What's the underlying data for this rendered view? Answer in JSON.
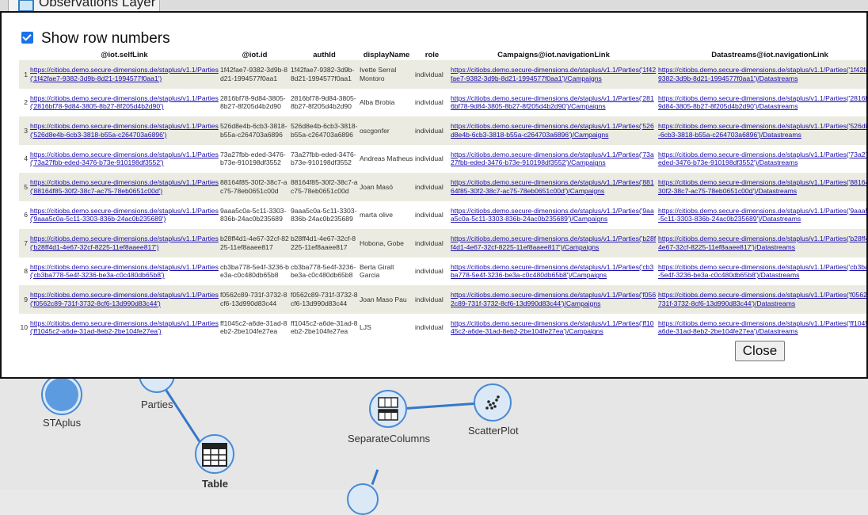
{
  "background": {
    "tab_label": "Observations Layer",
    "nodes": [
      {
        "id": "staplus",
        "label": "STAplus",
        "icon": "staplus-icon"
      },
      {
        "id": "parties",
        "label": "Parties",
        "icon": "parties-icon"
      },
      {
        "id": "table",
        "label": "Table",
        "icon": "table-icon"
      },
      {
        "id": "separatecolumns",
        "label": "SeparateColumns",
        "icon": "separate-columns-icon"
      },
      {
        "id": "scatterplot",
        "label": "ScatterPlot",
        "icon": "scatter-plot-icon"
      }
    ]
  },
  "modal": {
    "show_row_numbers_label": "Show row numbers",
    "show_row_numbers_checked": true,
    "close_label": "Close",
    "columns": [
      "@iot.selfLink",
      "@iot.id",
      "authId",
      "displayName",
      "role",
      "Campaigns@iot.navigationLink",
      "Datastreams@iot.navigationLink"
    ],
    "rows": [
      {
        "n": "1",
        "self": "https://citiobs.demo.secure-dimensions.de/staplus/v1.1/Parties('1f42fae7-9382-3d9b-8d21-1994577f0aa1')",
        "id": "1f42fae7-9382-3d9b-8d21-1994577f0aa1",
        "auth": "1f42fae7-9382-3d9b-8d21-1994577f0aa1",
        "name": "Ivette Serral Montoro",
        "role": "individual",
        "camp": "https://citiobs.demo.secure-dimensions.de/staplus/v1.1/Parties('1f42fae7-9382-3d9b-8d21-1994577f0aa1')/Campaigns",
        "ds": "https://citiobs.demo.secure-dimensions.de/staplus/v1.1/Parties('1f42fae7-9382-3d9b-8d21-1994577f0aa1')/Datastreams"
      },
      {
        "n": "2",
        "self": "https://citiobs.demo.secure-dimensions.de/staplus/v1.1/Parties('2816bf78-9d84-3805-8b27-8f205d4b2d90')",
        "id": "2816bf78-9d84-3805-8b27-8f205d4b2d90",
        "auth": "2816bf78-9d84-3805-8b27-8f205d4b2d90",
        "name": "Alba Brobia",
        "role": "individual",
        "camp": "https://citiobs.demo.secure-dimensions.de/staplus/v1.1/Parties('2816bf78-9d84-3805-8b27-8f205d4b2d90')/Campaigns",
        "ds": "https://citiobs.demo.secure-dimensions.de/staplus/v1.1/Parties('2816bf78-9d84-3805-8b27-8f205d4b2d90')/Datastreams"
      },
      {
        "n": "3",
        "self": "https://citiobs.demo.secure-dimensions.de/staplus/v1.1/Parties('526d8e4b-6cb3-3818-b55a-c264703a6896')",
        "id": "526d8e4b-6cb3-3818-b55a-c264703a6896",
        "auth": "526d8e4b-6cb3-3818-b55a-c264703a6896",
        "name": "oscgonfer",
        "role": "individual",
        "camp": "https://citiobs.demo.secure-dimensions.de/staplus/v1.1/Parties('526d8e4b-6cb3-3818-b55a-c264703a6896')/Campaigns",
        "ds": "https://citiobs.demo.secure-dimensions.de/staplus/v1.1/Parties('526d8e4b-6cb3-3818-b55a-c264703a6896')/Datastreams"
      },
      {
        "n": "4",
        "self": "https://citiobs.demo.secure-dimensions.de/staplus/v1.1/Parties('73a27fbb-eded-3476-b73e-910198df3552')",
        "id": "73a27fbb-eded-3476-b73e-910198df3552",
        "auth": "73a27fbb-eded-3476-b73e-910198df3552",
        "name": "Andreas Matheus",
        "role": "individual",
        "camp": "https://citiobs.demo.secure-dimensions.de/staplus/v1.1/Parties('73a27fbb-eded-3476-b73e-910198df3552')/Campaigns",
        "ds": "https://citiobs.demo.secure-dimensions.de/staplus/v1.1/Parties('73a27fbb-eded-3476-b73e-910198df3552')/Datastreams"
      },
      {
        "n": "5",
        "self": "https://citiobs.demo.secure-dimensions.de/staplus/v1.1/Parties('88164f85-30f2-38c7-ac75-78eb0651c00d')",
        "id": "88164f85-30f2-38c7-ac75-78eb0651c00d",
        "auth": "88164f85-30f2-38c7-ac75-78eb0651c00d",
        "name": "Joan Masó",
        "role": "individual",
        "camp": "https://citiobs.demo.secure-dimensions.de/staplus/v1.1/Parties('88164f85-30f2-38c7-ac75-78eb0651c00d')/Campaigns",
        "ds": "https://citiobs.demo.secure-dimensions.de/staplus/v1.1/Parties('88164f85-30f2-38c7-ac75-78eb0651c00d')/Datastreams"
      },
      {
        "n": "6",
        "self": "https://citiobs.demo.secure-dimensions.de/staplus/v1.1/Parties('9aaa5c0a-5c11-3303-836b-24ac0b235689')",
        "id": "9aaa5c0a-5c11-3303-836b-24ac0b235689",
        "auth": "9aaa5c0a-5c11-3303-836b-24ac0b235689",
        "name": "marta olive",
        "role": "individual",
        "camp": "https://citiobs.demo.secure-dimensions.de/staplus/v1.1/Parties('9aaa5c0a-5c11-3303-836b-24ac0b235689')/Campaigns",
        "ds": "https://citiobs.demo.secure-dimensions.de/staplus/v1.1/Parties('9aaa5c0a-5c11-3303-836b-24ac0b235689')/Datastreams"
      },
      {
        "n": "7",
        "self": "https://citiobs.demo.secure-dimensions.de/staplus/v1.1/Parties('b28ff4d1-4e67-32cf-8225-11ef8aaee817')",
        "id": "b28ff4d1-4e67-32cf-8225-11ef8aaee817",
        "auth": "b28ff4d1-4e67-32cf-8225-11ef8aaee817",
        "name": "Hobona, Gobe",
        "role": "individual",
        "camp": "https://citiobs.demo.secure-dimensions.de/staplus/v1.1/Parties('b28ff4d1-4e67-32cf-8225-11ef8aaee817')/Campaigns",
        "ds": "https://citiobs.demo.secure-dimensions.de/staplus/v1.1/Parties('b28ff4d1-4e67-32cf-8225-11ef8aaee817')/Datastreams"
      },
      {
        "n": "8",
        "self": "https://citiobs.demo.secure-dimensions.de/staplus/v1.1/Parties('cb3ba778-5e4f-3236-be3a-c0c480db65b8')",
        "id": "cb3ba778-5e4f-3236-be3a-c0c480db65b8",
        "auth": "cb3ba778-5e4f-3236-be3a-c0c480db65b8",
        "name": "Berta Giralt Garcia",
        "role": "individual",
        "camp": "https://citiobs.demo.secure-dimensions.de/staplus/v1.1/Parties('cb3ba778-5e4f-3236-be3a-c0c480db65b8')/Campaigns",
        "ds": "https://citiobs.demo.secure-dimensions.de/staplus/v1.1/Parties('cb3ba778-5e4f-3236-be3a-c0c480db65b8')/Datastreams"
      },
      {
        "n": "9",
        "self": "https://citiobs.demo.secure-dimensions.de/staplus/v1.1/Parties('f0562c89-731f-3732-8cf6-13d990d83c44')",
        "id": "f0562c89-731f-3732-8cf6-13d990d83c44",
        "auth": "f0562c89-731f-3732-8cf6-13d990d83c44",
        "name": "Joan Maso Pau",
        "role": "individual",
        "camp": "https://citiobs.demo.secure-dimensions.de/staplus/v1.1/Parties('f0562c89-731f-3732-8cf6-13d990d83c44')/Campaigns",
        "ds": "https://citiobs.demo.secure-dimensions.de/staplus/v1.1/Parties('f0562c89-731f-3732-8cf6-13d990d83c44')/Datastreams"
      },
      {
        "n": "10",
        "self": "https://citiobs.demo.secure-dimensions.de/staplus/v1.1/Parties('ff1045c2-a6de-31ad-8eb2-2be104fe27ea')",
        "id": "ff1045c2-a6de-31ad-8eb2-2be104fe27ea",
        "auth": "ff1045c2-a6de-31ad-8eb2-2be104fe27ea",
        "name": "LJS",
        "role": "individual",
        "camp": "https://citiobs.demo.secure-dimensions.de/staplus/v1.1/Parties('ff1045c2-a6de-31ad-8eb2-2be104fe27ea')/Campaigns",
        "ds": "https://citiobs.demo.secure-dimensions.de/staplus/v1.1/Parties('ff1045c2-a6de-31ad-8eb2-2be104fe27ea')/Datastreams"
      }
    ]
  }
}
